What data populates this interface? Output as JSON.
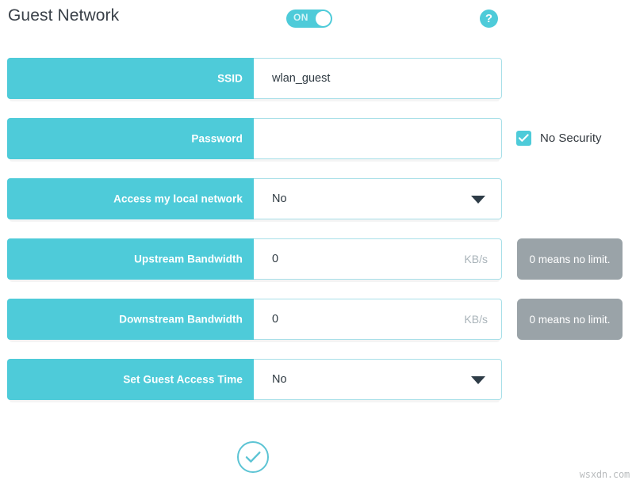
{
  "header": {
    "title": "Guest Network",
    "toggle": {
      "label": "ON",
      "state": "on"
    },
    "help_icon": "?"
  },
  "colors": {
    "accent_teal": "#4ecbd9",
    "input_border": "#a8dfe8",
    "hint_gray": "#9aa3a8",
    "title_text": "#3a4149"
  },
  "form": {
    "rows": [
      {
        "label": "SSID",
        "type": "text",
        "value": "wlan_guest",
        "unit": "",
        "addon": "none"
      },
      {
        "label": "Password",
        "type": "password",
        "value": "",
        "unit": "",
        "addon": "checkbox",
        "checkbox": {
          "label": "No Security",
          "checked": true
        }
      },
      {
        "label": "Access my local network",
        "type": "select",
        "value": "No",
        "unit": "",
        "addon": "none"
      },
      {
        "label": "Upstream Bandwidth",
        "type": "text",
        "value": "0",
        "unit": "KB/s",
        "addon": "hint",
        "hint": "0 means no limit."
      },
      {
        "label": "Downstream Bandwidth",
        "type": "text",
        "value": "0",
        "unit": "KB/s",
        "addon": "hint",
        "hint": "0 means no limit."
      },
      {
        "label": "Set Guest Access Time",
        "type": "select",
        "value": "No",
        "unit": "",
        "addon": "none"
      }
    ]
  },
  "footer": {
    "submit_icon": "check-circle",
    "watermark": "wsxdn.com"
  }
}
